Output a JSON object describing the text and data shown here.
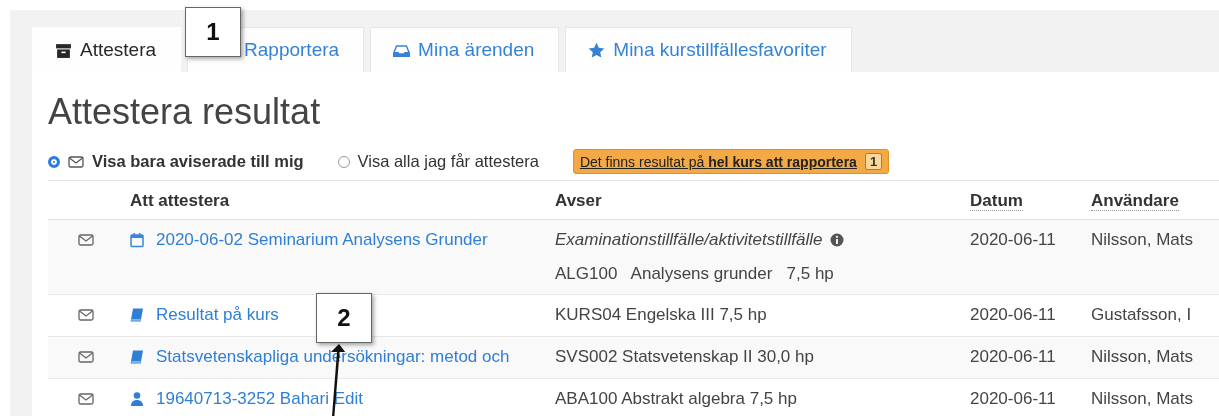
{
  "tabs": [
    {
      "label": "Attestera",
      "kind": "archive",
      "selected": true
    },
    {
      "label": "Rapportera",
      "kind": "plain",
      "selected": false
    },
    {
      "label": "Mina ärenden",
      "kind": "inbox",
      "selected": false
    },
    {
      "label": "Mina kurstillfällesfavoriter",
      "kind": "star",
      "selected": false
    }
  ],
  "heading": "Attestera resultat",
  "filters": [
    {
      "label": "Visa bara aviserade till mig",
      "kind": "mail",
      "selected": true
    },
    {
      "label": "Visa alla jag får attestera",
      "kind": "plain",
      "selected": false
    }
  ],
  "alert": {
    "text": "Det finns resultat på **hel kurs att rapportera**",
    "count": "1"
  },
  "table": {
    "columns": [
      "Att attestera",
      "Avser",
      "Datum",
      "Användare"
    ],
    "rows": [
      {
        "kind": "calendar",
        "title": "2020-06-02 Seminarium Analysens Grunder",
        "avser_type": "Examinationstillfälle/aktivitetstillfälle",
        "avser": "ALG100   Analysens grunder   7,5 hp",
        "date": "2020-06-11",
        "user": "Nilsson, Mats"
      },
      {
        "kind": "book",
        "title": "Resultat på kurs",
        "avser": "KURS04 Engelska III 7,5 hp",
        "date": "2020-06-11",
        "user": "Gustafsson, I"
      },
      {
        "kind": "book",
        "title": "Statsvetenskapliga undersökningar: metod och",
        "avser": "SVS002 Statsvetenskap II 30,0 hp",
        "date": "2020-06-11",
        "user": "Nilsson, Mats"
      },
      {
        "kind": "user",
        "title": "19640713-3252 Bahari Edit",
        "avser": "ABA100 Abstrakt algebra 7,5 hp",
        "date": "2020-06-11",
        "user": "Nilsson, Mats"
      }
    ]
  },
  "callouts": [
    {
      "label": "1"
    },
    {
      "label": "2"
    }
  ]
}
